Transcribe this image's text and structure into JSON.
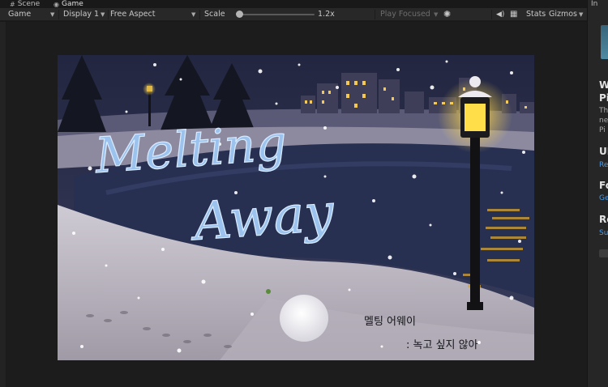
{
  "tabs": [
    {
      "label": "Scene",
      "icon": "grid-icon"
    },
    {
      "label": "Game",
      "icon": "gamepad-icon"
    }
  ],
  "toolbar": {
    "view_mode": "Game",
    "display": "Display 1",
    "aspect": "Free Aspect",
    "scale_label": "Scale",
    "scale_value": "1.2x",
    "scale_fraction": 0.02,
    "play_focused": "Play Focused",
    "stats": "Stats",
    "gizmos": "Gizmos"
  },
  "game": {
    "title_line1": "Melting",
    "title_line2": "Away",
    "subtitle_kr": "멜팅 어웨이",
    "tagline_kr": ": 녹고 싶지 않아"
  },
  "inspector": {
    "tab": "In",
    "heading_1": "W",
    "heading_1b": "Pi",
    "text_lines": [
      "Th",
      "ne",
      "Pi"
    ],
    "section_2": "UI",
    "link_2": "Re",
    "section_3": "Fo",
    "link_3": "Ge",
    "section_4": "Re",
    "link_4": "Su"
  },
  "colors": {
    "editor_bg": "#191919",
    "toolbar_bg": "#282828",
    "link_blue": "#4d9be6",
    "night_sky": "#262a45",
    "lamp_glow": "#ffd84a",
    "title_blue": "#8fb8e8"
  }
}
